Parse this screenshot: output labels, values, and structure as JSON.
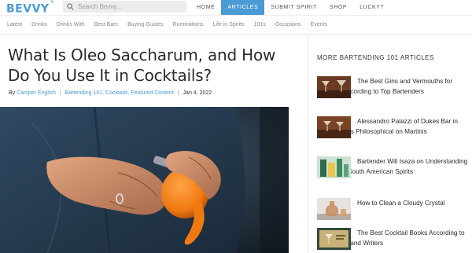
{
  "brand": {
    "logo": "BEVVY",
    "mark": "®"
  },
  "search": {
    "placeholder": "Search Bevvy..."
  },
  "main_nav": {
    "items": [
      {
        "label": "HOME",
        "active": false
      },
      {
        "label": "ARTICLES",
        "active": true
      },
      {
        "label": "SUBMIT SPIRIT",
        "active": false
      },
      {
        "label": "SHOP",
        "active": false
      },
      {
        "label": "LUCKY?",
        "active": false
      }
    ]
  },
  "sub_nav": {
    "items": [
      "Latest",
      "Drinks",
      "Drinks With",
      "Best Bars",
      "Buying Guides",
      "Ruminations",
      "Life in Spirits",
      "101s",
      "Occasions",
      "Events"
    ]
  },
  "article": {
    "title": "What Is Oleo Saccharum, and How Do You Use It in Cocktails?",
    "by": "By",
    "author": "Camper English",
    "sep": "|",
    "categories": "Bartending 101, Cocktails, Featured Content",
    "date": "Jan 4, 2022"
  },
  "sidebar": {
    "heading": "MORE BARTENDING 101 ARTICLES",
    "articles": [
      {
        "title": "The Best Gins and Vermouths for Martinis, According to Top Bartenders"
      },
      {
        "title": "Alessandro Palazzi of Dukes Bar in London Gets Philosophical on Martinis"
      },
      {
        "title": "Bartender Will Isaza on Understanding and Using South American Spirits"
      },
      {
        "title": "How to Clean a Cloudy Crystal Decanter?"
      },
      {
        "title": "The Best Cocktail Books According to Bartenders and Writers"
      }
    ]
  },
  "colors": {
    "accent": "#4a9ad4",
    "text": "#2b2b2b",
    "muted": "#888888"
  }
}
